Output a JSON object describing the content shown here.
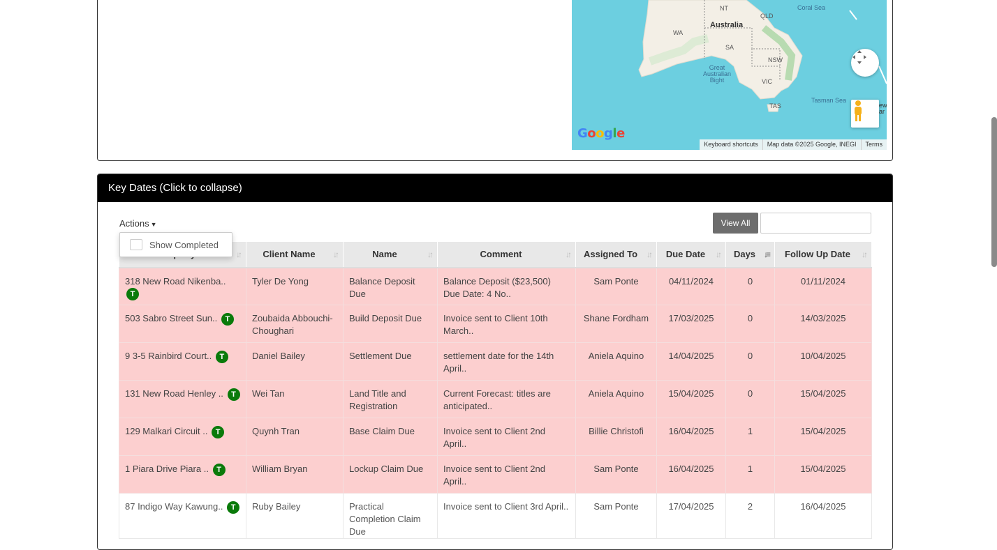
{
  "map": {
    "labels": {
      "nt": "NT",
      "qld": "QLD",
      "wa": "WA",
      "sa": "SA",
      "nsw": "NSW",
      "vic": "VIC",
      "tas": "TAS",
      "australia": "Australia",
      "coral_sea": "Coral Sea",
      "tasman_sea": "Tasman Sea",
      "bight": "Great\nAustralian\nBight",
      "new": "ew\nar"
    },
    "google": "Google",
    "footer": {
      "shortcuts": "Keyboard shortcuts",
      "map_data": "Map data ©2025 Google, INEGI",
      "terms": "Terms"
    }
  },
  "panel": {
    "title": "Key Dates (Click to collapse)",
    "actions_label": "Actions",
    "view_all_label": "View All",
    "search_placeholder": "",
    "show_completed_label": "Show Completed"
  },
  "table": {
    "columns": [
      {
        "label": "Property"
      },
      {
        "label": "Client Name"
      },
      {
        "label": "Name"
      },
      {
        "label": "Comment"
      },
      {
        "label": "Assigned To"
      },
      {
        "label": "Due Date"
      },
      {
        "label": "Days"
      },
      {
        "label": "Follow Up Date"
      }
    ],
    "rows": [
      {
        "property": "318 New Road Nikenba..",
        "badge": "T",
        "client": "Tyler De Yong",
        "name": "Balance Deposit Due",
        "comment": "Balance Deposit ($23,500) Due Date: 4 No..",
        "assigned": "Sam Ponte",
        "due": "04/11/2024",
        "days": "0",
        "follow": "01/11/2024",
        "status": "overdue"
      },
      {
        "property": "503 Sabro Street Sun..",
        "badge": "T",
        "client": "Zoubaida Abbouchi-Choughari",
        "name": "Build Deposit Due",
        "comment": "Invoice sent to Client 10th March..",
        "assigned": "Shane Fordham",
        "due": "17/03/2025",
        "days": "0",
        "follow": "14/03/2025",
        "status": "overdue"
      },
      {
        "property": "9 3-5 Rainbird Court..",
        "badge": "T",
        "client": "Daniel Bailey",
        "name": "Settlement Due",
        "comment": "settlement date for the 14th April..",
        "assigned": "Aniela Aquino",
        "due": "14/04/2025",
        "days": "0",
        "follow": "10/04/2025",
        "status": "overdue"
      },
      {
        "property": "131 New Road Henley ..",
        "badge": "T",
        "client": "Wei Tan",
        "name": "Land Title and Registration",
        "comment": "Current Forecast: titles are anticipated..",
        "assigned": "Aniela Aquino",
        "due": "15/04/2025",
        "days": "0",
        "follow": "15/04/2025",
        "status": "overdue"
      },
      {
        "property": "129 Malkari Circuit ..",
        "badge": "T",
        "client": "Quynh Tran",
        "name": "Base Claim Due",
        "comment": "Invoice sent to Client 2nd April..",
        "assigned": "Billie Christofi",
        "due": "16/04/2025",
        "days": "1",
        "follow": "15/04/2025",
        "status": "overdue"
      },
      {
        "property": "1 Piara Drive Piara ..",
        "badge": "T",
        "client": "William Bryan",
        "name": "Lockup Claim Due",
        "comment": "Invoice sent to Client 2nd April..",
        "assigned": "Sam Ponte",
        "due": "16/04/2025",
        "days": "1",
        "follow": "15/04/2025",
        "status": "overdue"
      },
      {
        "property": "87 Indigo Way Kawung..",
        "badge": "T",
        "client": "Ruby Bailey",
        "name": "Practical Completion Claim Due",
        "comment": "Invoice sent to Client 3rd April..",
        "assigned": "Sam Ponte",
        "due": "17/04/2025",
        "days": "2",
        "follow": "16/04/2025",
        "status": "normal"
      }
    ]
  },
  "colors": {
    "overdue_row": "#fccfcf",
    "badge": "#0a7a0a",
    "header_bg": "#000000",
    "map_water": "#6ccfe0"
  },
  "icons": {
    "search": "search-icon",
    "sort": "sort-icon",
    "sort_active": "sort-numeric-asc-icon",
    "map_move": "map-pan-icon",
    "pegman": "street-view-pegman-icon",
    "caret": "caret-down-icon"
  }
}
